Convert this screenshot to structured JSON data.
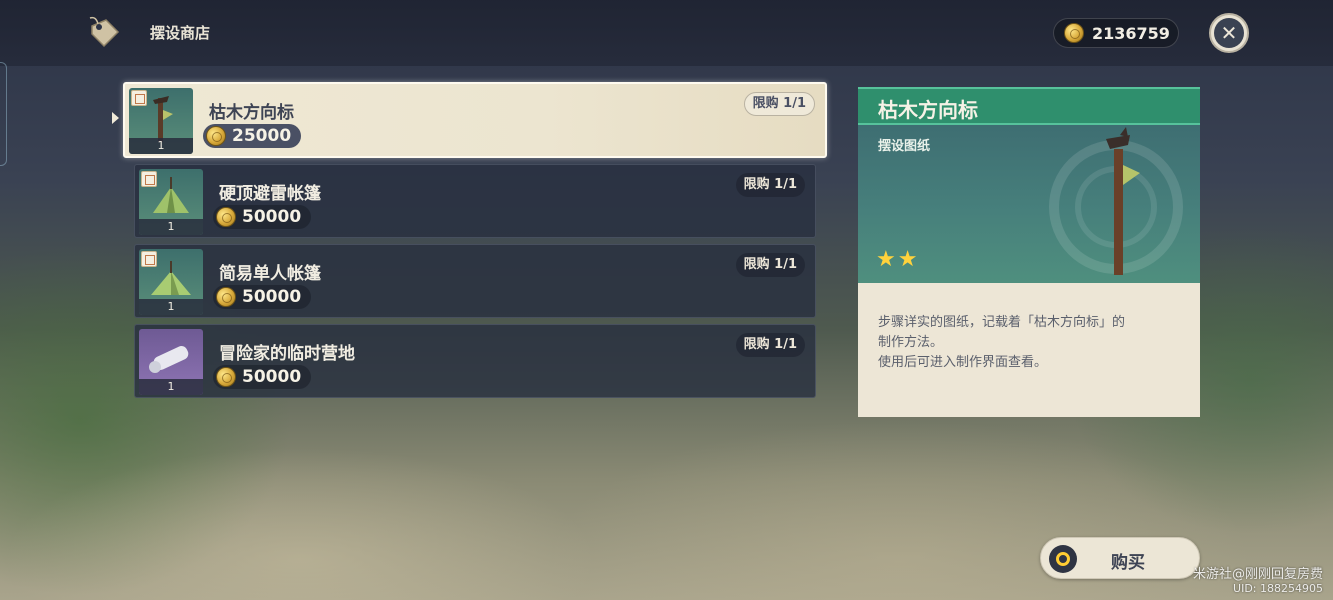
{
  "header": {
    "shop_title": "摆设商店",
    "currency_amount": "2136759",
    "icons": {
      "shop": "price-tag-icon",
      "close": "close-icon",
      "currency": "mora-coin-icon"
    }
  },
  "items": [
    {
      "name": "枯木方向标",
      "price": "25000",
      "limit": "限购 1/1",
      "count": "1",
      "selected": true
    },
    {
      "name": "硬顶避雷帐篷",
      "price": "50000",
      "limit": "限购 1/1",
      "count": "1",
      "selected": false
    },
    {
      "name": "简易单人帐篷",
      "price": "50000",
      "limit": "限购 1/1",
      "count": "1",
      "selected": false
    },
    {
      "name": "冒险家的临时营地",
      "price": "50000",
      "limit": "限购 1/1",
      "count": "1",
      "selected": false
    }
  ],
  "detail": {
    "title": "枯木方向标",
    "type": "摆设图纸",
    "rarity": 2,
    "stars": "★★",
    "description_lines": [
      "步骤详实的图纸，记载着「枯木方向标」的",
      "制作方法。",
      "使用后可进入制作界面查看。"
    ]
  },
  "buy_button": {
    "label": "购买"
  },
  "watermark": {
    "line1": "米游社@刚刚回复房费",
    "line2": "UID: 188254905"
  },
  "colors": {
    "accent_green": "#2f8f6d",
    "gold": "#d8a93a",
    "panel_cream": "#ede6d6",
    "dark_panel": "#283040"
  }
}
